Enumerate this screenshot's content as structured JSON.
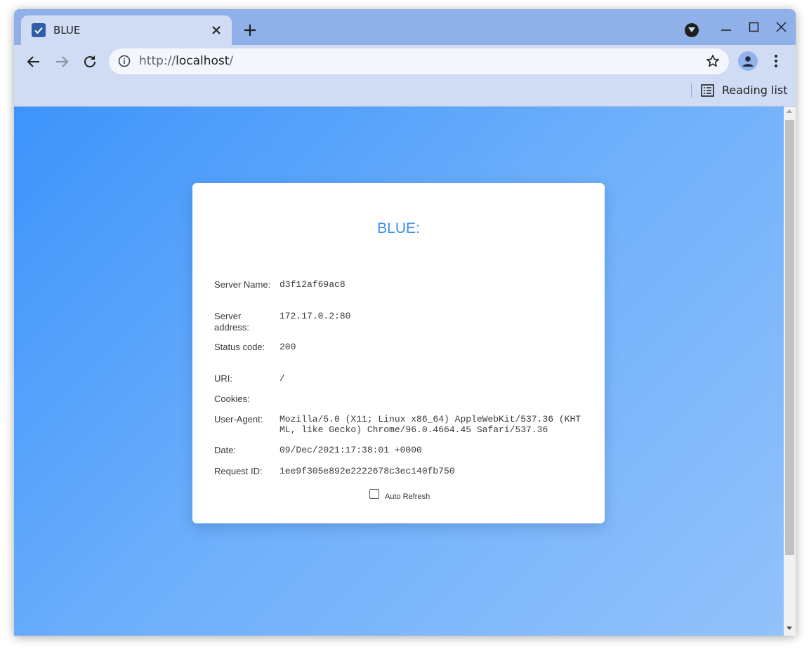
{
  "browser": {
    "tab": {
      "title": "BLUE",
      "favicon": "checkbox-icon"
    },
    "address_bar": {
      "url_scheme": "http://",
      "url_host": "localhost",
      "url_path": "/"
    },
    "bookmarks_bar": {
      "reading_list_label": "Reading list"
    },
    "colors": {
      "tabstrip": "#8fb0e8",
      "toolbar": "#cfdcf4",
      "omnibox": "#f3f6fc"
    }
  },
  "page": {
    "title": "BLUE:",
    "rows": [
      {
        "label": "Server Name:",
        "value": "d3f12af69ac8"
      },
      {
        "label": "Server address:",
        "value": "172.17.0.2:80"
      },
      {
        "label": "Status code:",
        "value": "200"
      },
      {
        "label": "URI:",
        "value": "/"
      },
      {
        "label": "Cookies:",
        "value": ""
      },
      {
        "label": "User-Agent:",
        "value": "Mozilla/5.0 (X11; Linux x86_64) AppleWebKit/537.36 (KHTML, like Gecko) Chrome/96.0.4664.45 Safari/537.36"
      },
      {
        "label": "Date:",
        "value": "09/Dec/2021:17:38:01 +0000"
      },
      {
        "label": "Request ID:",
        "value": "1ee9f305e892e2222678c3ec140fb750"
      }
    ],
    "auto_refresh": {
      "label": "Auto Refresh",
      "checked": false
    },
    "colors": {
      "title": "#3d8fe8",
      "gradient_start": "#3d94fb",
      "gradient_end": "#93c2fb"
    }
  }
}
